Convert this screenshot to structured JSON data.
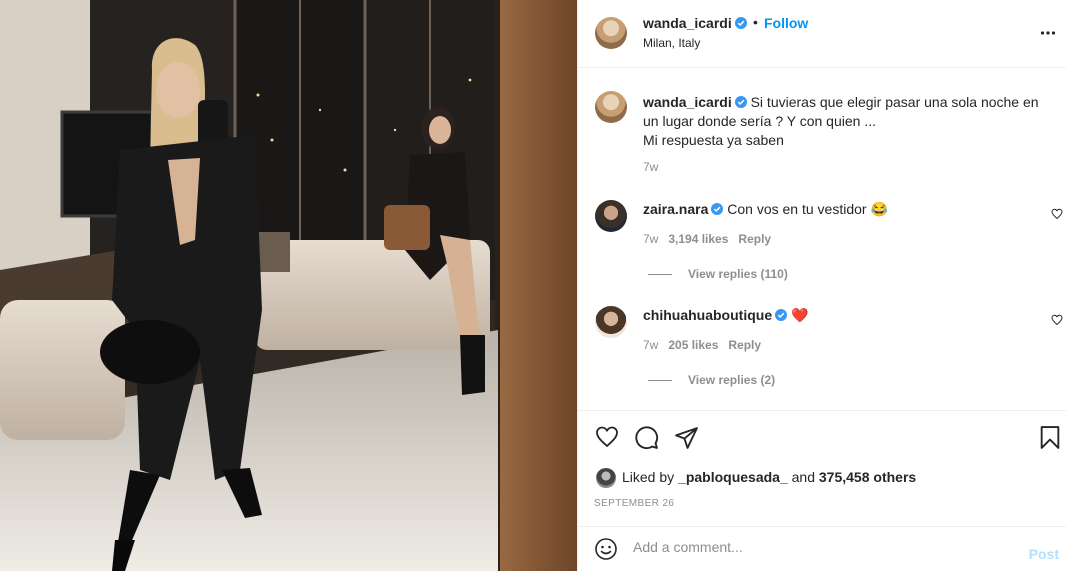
{
  "post": {
    "username": "wanda_icardi",
    "follow_label": "Follow",
    "separator": "•",
    "location": "Milan, Italy",
    "caption_text": "Si tuvieras que elegir pasar una sola noche en un lugar donde sería ? Y con quien ...",
    "caption_line2": "Mi respuesta ya saben",
    "caption_age": "7w"
  },
  "comments": [
    {
      "username": "zaira.nara",
      "text": "Con vos en tu vestidor 😂",
      "age": "7w",
      "likes": "3,194 likes",
      "reply_label": "Reply",
      "view_replies": "View replies (110)"
    },
    {
      "username": "chihuahuaboutique",
      "text": "❤️",
      "age": "7w",
      "likes": "205 likes",
      "reply_label": "Reply",
      "view_replies": "View replies (2)"
    }
  ],
  "likes": {
    "prefix": "Liked by",
    "user": "_pabloquesada_",
    "and": "and",
    "others": "375,458 others"
  },
  "date": "SEPTEMBER 26",
  "add_comment": {
    "placeholder": "Add a comment...",
    "post_label": "Post"
  },
  "icons": {
    "verified": "verified-badge-icon",
    "more": "more-options-icon",
    "like": "heart-icon",
    "comment": "comment-bubble-icon",
    "share": "share-plane-icon",
    "save": "bookmark-icon",
    "emoji": "emoji-icon"
  },
  "colors": {
    "accent": "#0095f6",
    "verified": "#3897f0",
    "muted": "#8e8e8e",
    "post_disabled": "#b2dffc",
    "border": "#efefef"
  }
}
